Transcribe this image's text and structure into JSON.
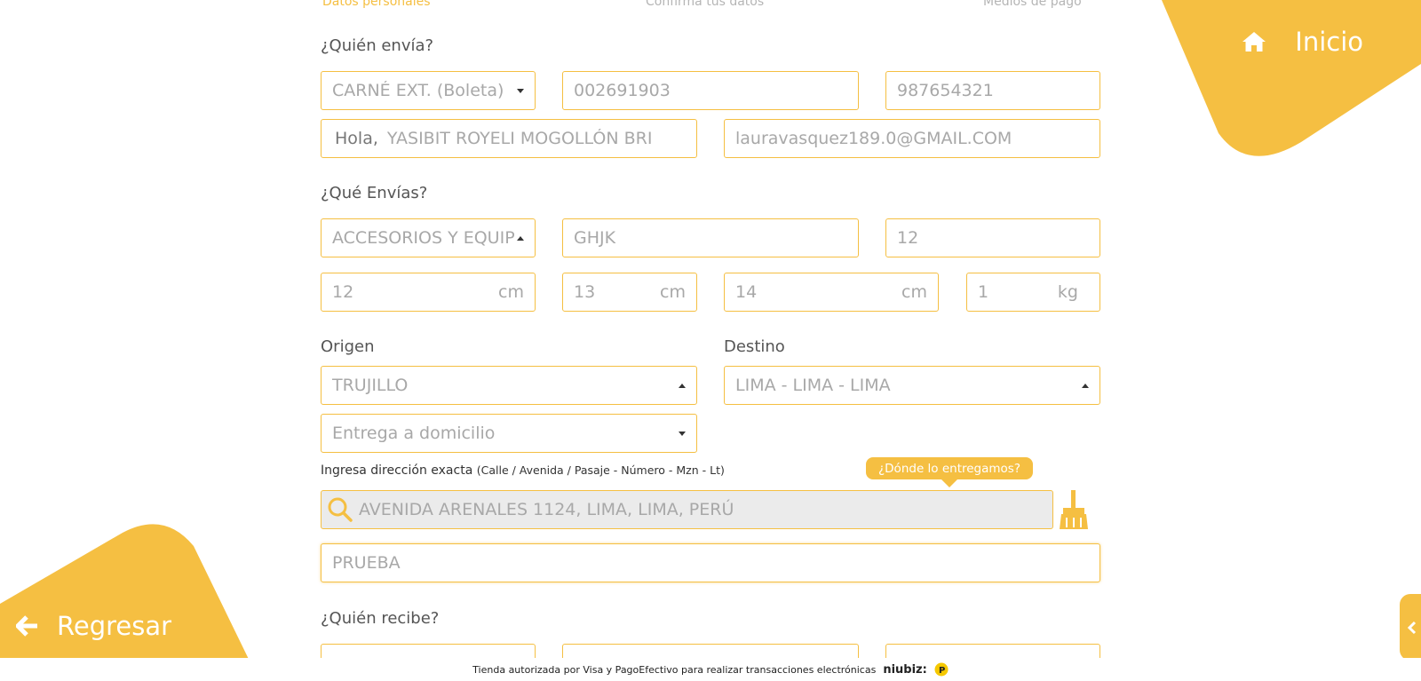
{
  "steps": [
    "Datos personales",
    "Confirma tus datos",
    "Medios de pago"
  ],
  "nav": {
    "home_label": "Inicio",
    "back_label": "Regresar"
  },
  "sender": {
    "title": "¿Quién envía?",
    "doc_type": "CARNÉ EXT. (Boleta)",
    "doc_number": "002691903",
    "phone": "987654321",
    "greeting": "Hola,",
    "name": "YASIBIT ROYELI MOGOLLÓN BRI",
    "email": "lauravasquez189.0@GMAIL.COM"
  },
  "package": {
    "title": "¿Qué Envías?",
    "category": "ACCESORIOS Y EQUIP",
    "description": "GHJK",
    "quantity": "12",
    "length": "12",
    "width": "13",
    "height": "14",
    "weight": "1",
    "unit_cm": "cm",
    "unit_kg": "kg"
  },
  "route": {
    "origin_label": "Origen",
    "origin": "TRUJILLO",
    "destination_label": "Destino",
    "destination": "LIMA - LIMA - LIMA",
    "delivery_type": "Entrega a domicilio"
  },
  "address": {
    "label": "Ingresa dirección exacta",
    "hint": "(Calle / Avenida / Pasaje - Número - Mzn - Lt)",
    "tooltip": "¿Dónde lo entregamos?",
    "value": "AVENIDA ARENALES 1124, LIMA, LIMA, PERÚ",
    "reference": "PRUEBA"
  },
  "receiver": {
    "title": "¿Quién recibe?"
  },
  "footer": {
    "text": "Tienda autorizada por Visa y PagoEfectivo para realizar transacciones electrónicas",
    "brand": "niubiz:"
  },
  "colors": {
    "accent": "#f5bf42"
  }
}
